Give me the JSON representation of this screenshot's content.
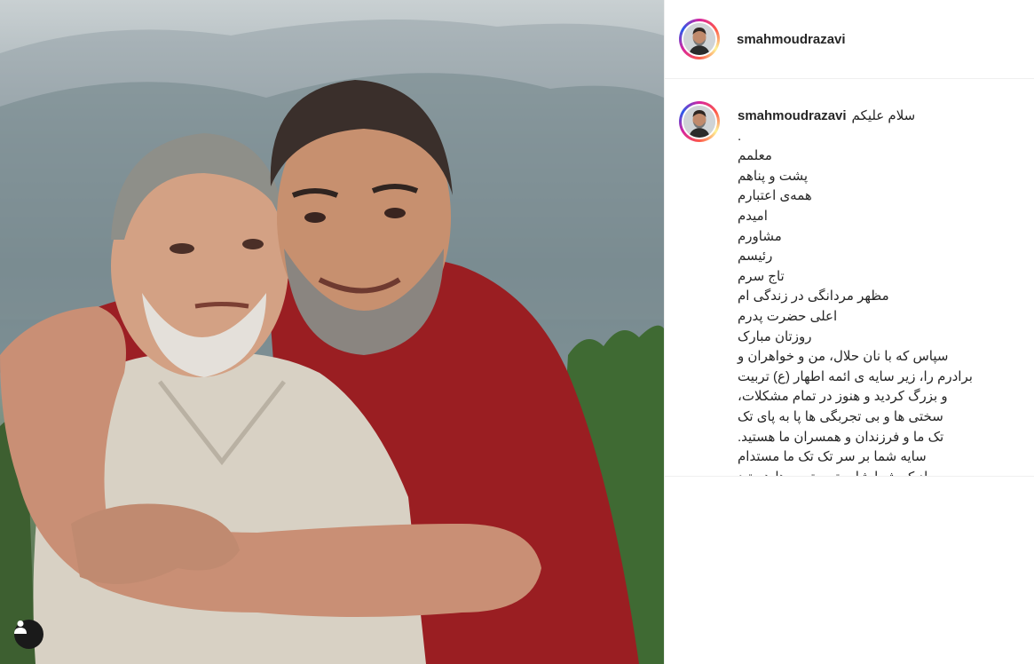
{
  "post": {
    "username": "smahmoudrazavi",
    "caption_greeting": "سلام علیکم",
    "caption_lines": [
      ".",
      "معلمم",
      "پشت و پناهم",
      "همه‌ی اعتبارم",
      "امیدم",
      "مشاورم",
      "رئیسم",
      "تاج سرم",
      "مظهر مردانگی در زندگی ام",
      "اعلی حضرت پدرم",
      "روزتان مبارک"
    ],
    "caption_paragraph_lines": [
      "سپاس که با نان حلال، من و خواهران و",
      "برادرم را، زیر سایه ی ائمه اطهار (ع) تربیت",
      "و بزرگ کردید و هنوز در تمام مشکلات،",
      "سختی ها و بی تجربگی ها پا به پای تک",
      "تک ما و فرزندان و همسران ما هستید.",
      "سایه شما بر سر تک تک ما مستدام",
      "باد که شما شایسته بهترین ها هستید"
    ]
  },
  "icons": {
    "user_tag": "user-silhouette-icon",
    "avatar": "profile-avatar"
  },
  "colors": {
    "ring_start": "#d6249f",
    "ring_end": "#285aeb",
    "shirt_red": "#9a1e22",
    "shirt_beige": "#d8d1c4"
  }
}
